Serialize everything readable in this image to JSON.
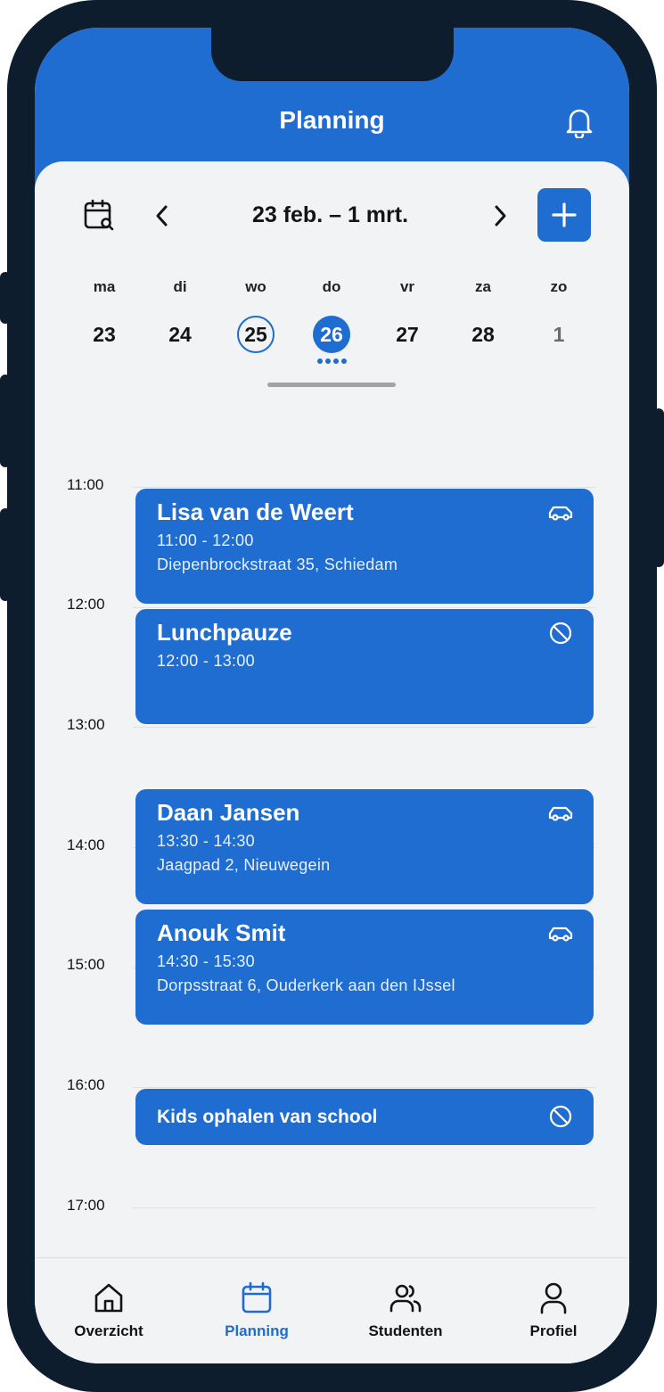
{
  "header": {
    "title": "Planning"
  },
  "toolbar": {
    "range_label": "23 feb. – 1 mrt."
  },
  "week": [
    {
      "name": "ma",
      "num": "23"
    },
    {
      "name": "di",
      "num": "24"
    },
    {
      "name": "wo",
      "num": "25"
    },
    {
      "name": "do",
      "num": "26"
    },
    {
      "name": "vr",
      "num": "27"
    },
    {
      "name": "za",
      "num": "28"
    },
    {
      "name": "zo",
      "num": "1"
    }
  ],
  "times": [
    "11:00",
    "12:00",
    "13:00",
    "14:00",
    "15:00",
    "16:00",
    "17:00"
  ],
  "events": [
    {
      "title": "Lisa van de Weert",
      "time": "11:00 - 12:00",
      "address": "Diepenbrockstraat 35, Schiedam",
      "icon": "car-icon"
    },
    {
      "title": "Lunchpauze",
      "time": "12:00 - 13:00",
      "icon": "blocked-icon"
    },
    {
      "title": "Daan Jansen",
      "time": "13:30 - 14:30",
      "address": "Jaagpad 2, Nieuwegein",
      "icon": "car-icon"
    },
    {
      "title": "Anouk Smit",
      "time": "14:30 - 15:30",
      "address": "Dorpsstraat 6, Ouderkerk aan den IJssel",
      "icon": "car-icon"
    },
    {
      "title": "Kids ophalen van school",
      "icon": "blocked-icon"
    }
  ],
  "nav": [
    {
      "label": "Overzicht",
      "icon": "home-icon"
    },
    {
      "label": "Planning",
      "icon": "calendar-icon"
    },
    {
      "label": "Studenten",
      "icon": "users-icon"
    },
    {
      "label": "Profiel",
      "icon": "user-icon"
    }
  ],
  "colors": {
    "primary": "#1f6dd1",
    "frame": "#0e1d2e",
    "background": "#f2f3f5"
  }
}
